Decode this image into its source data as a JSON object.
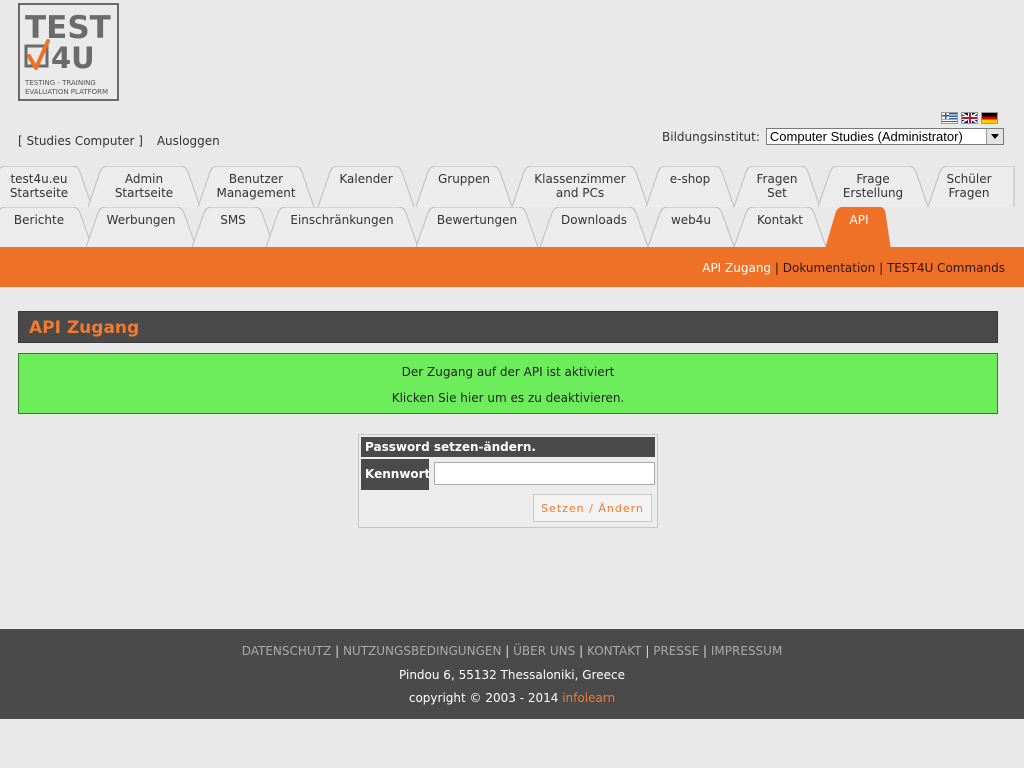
{
  "logo": {
    "line1": "TEST",
    "line2": "4U",
    "tag1": "TESTING - TRAINING",
    "tag2": "EVALUATION PLATFORM"
  },
  "flags": [
    "greek-flag-icon",
    "uk-flag-icon",
    "german-flag-icon"
  ],
  "userbar": {
    "user": "[ Studies Computer ]",
    "logout": "Ausloggen"
  },
  "institut": {
    "label": "Bildungsinstitut:",
    "selected": "Computer Studies (Administrator)"
  },
  "tabs_row1": [
    {
      "l1": "test4u.eu",
      "l2": "Startseite"
    },
    {
      "l1": "Admin",
      "l2": "Startseite"
    },
    {
      "l1": "Benutzer",
      "l2": "Management"
    },
    {
      "l1": "Kalender",
      "l2": ""
    },
    {
      "l1": "Gruppen",
      "l2": ""
    },
    {
      "l1": "Klassenzimmer",
      "l2": "and PCs"
    },
    {
      "l1": "e-shop",
      "l2": ""
    },
    {
      "l1": "Fragen",
      "l2": "Set"
    },
    {
      "l1": "Frage",
      "l2": "Erstellung"
    },
    {
      "l1": "Schüler",
      "l2": "Fragen"
    }
  ],
  "tabs_row2": [
    {
      "l1": "Berichte"
    },
    {
      "l1": "Werbungen"
    },
    {
      "l1": "SMS"
    },
    {
      "l1": "Einschränkungen"
    },
    {
      "l1": "Bewertungen"
    },
    {
      "l1": "Downloads"
    },
    {
      "l1": "web4u"
    },
    {
      "l1": "Kontakt"
    },
    {
      "l1": "API"
    }
  ],
  "subnav": {
    "current": "API Zugang",
    "sep": "|",
    "docs": "Dokumentation",
    "commands": "TEST4U Commands"
  },
  "page_title": "API Zugang",
  "message": {
    "line1": "Der Zugang auf der API ist aktiviert",
    "line2": "Klicken Sie hier um es zu deaktivieren."
  },
  "password_form": {
    "heading": "Password setzen-ändern.",
    "label": "Kennwort",
    "value": "",
    "button": "Setzen / Ändern"
  },
  "footer": {
    "links": [
      "DATENSCHUTZ",
      "NUTZUNGSBEDINGUNGEN",
      "ÜBER UNS",
      "KONTAKT",
      "PRESSE",
      "IMPRESSUM"
    ],
    "sep": "|",
    "address": "Pindou 6, 55132 Thessaloniki, Greece",
    "copyright": "copyright © 2003 - 2014",
    "brand": "infolearn"
  },
  "colors": {
    "accent": "#ef7127",
    "dark": "#4a4a4a",
    "success": "#6ded5c"
  }
}
